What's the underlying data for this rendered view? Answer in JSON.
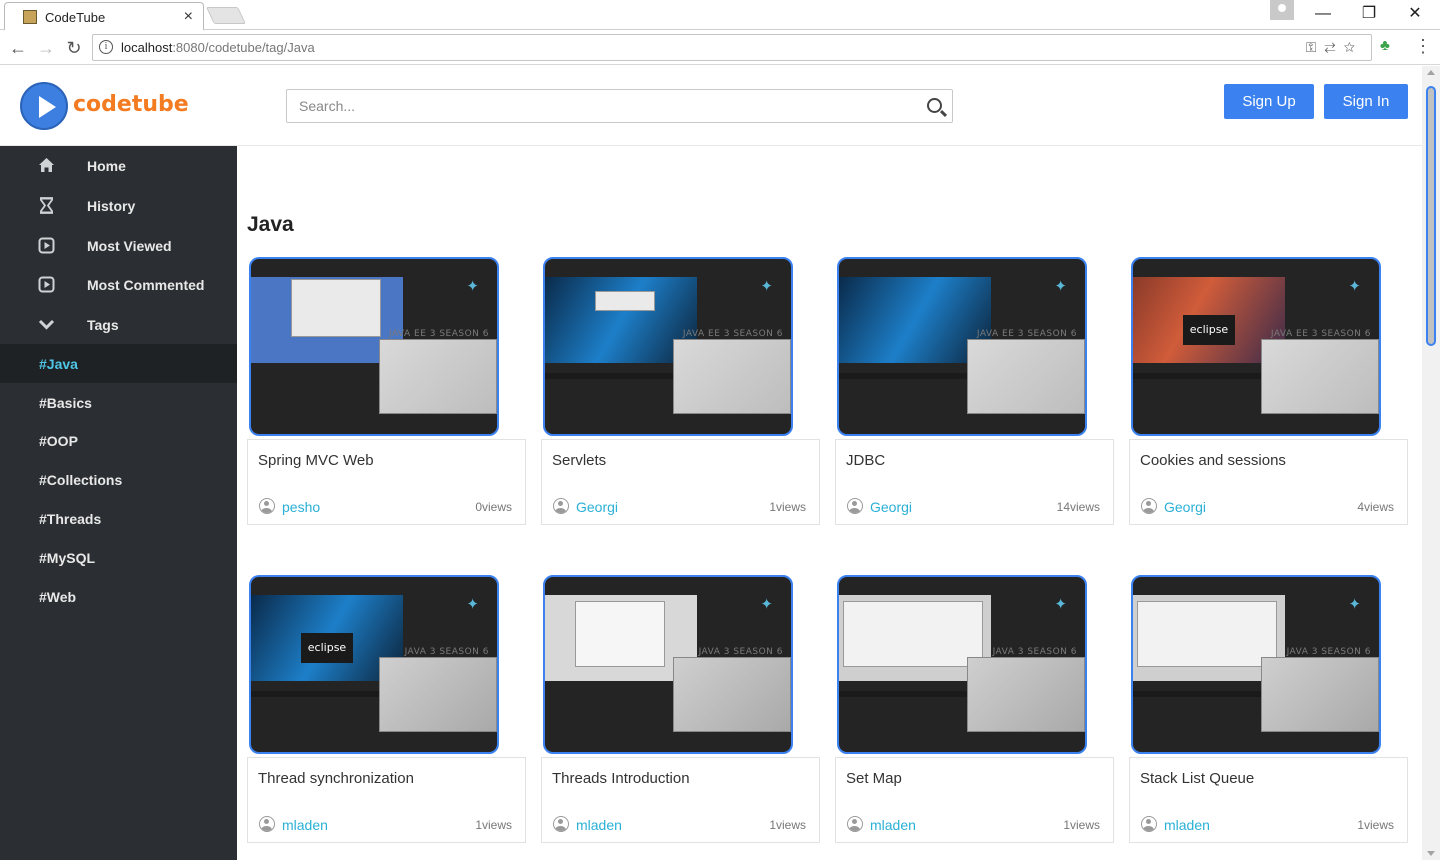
{
  "browser": {
    "tab_title": "CodeTube",
    "tab_close": "×",
    "url_host": "localhost",
    "url_rest": ":8080/codetube/tag/Java",
    "window_controls": [
      "—",
      "❐",
      "✕"
    ]
  },
  "header": {
    "logo_text": "codetube",
    "search_placeholder": "Search...",
    "sign_up_label": "Sign Up",
    "sign_in_label": "Sign In"
  },
  "sidebar": {
    "nav": [
      {
        "label": "Home",
        "icon": "home-icon"
      },
      {
        "label": "History",
        "icon": "hourglass-icon"
      },
      {
        "label": "Most Viewed",
        "icon": "play-square-icon"
      },
      {
        "label": "Most Commented",
        "icon": "play-square-icon"
      },
      {
        "label": "Tags",
        "icon": "chevron-down-icon"
      }
    ],
    "tags": [
      "#Java",
      "#Basics",
      "#OOP",
      "#Collections",
      "#Threads",
      "#MySQL",
      "#Web"
    ],
    "active_tag": "#Java"
  },
  "main": {
    "section_title": "Java",
    "videos": [
      {
        "title": "Spring MVC Web",
        "author": "pesho",
        "views": "0views",
        "season": "JAVA EE 3 SEASON 6"
      },
      {
        "title": "Servlets",
        "author": "Georgi",
        "views": "1views",
        "season": "JAVA EE 3 SEASON 6"
      },
      {
        "title": "JDBC",
        "author": "Georgi",
        "views": "14views",
        "season": "JAVA EE 3 SEASON 6"
      },
      {
        "title": "Cookies and sessions",
        "author": "Georgi",
        "views": "4views",
        "season": "JAVA EE 3 SEASON 6"
      },
      {
        "title": "Thread synchronization",
        "author": "mladen",
        "views": "1views",
        "season": "JAVA 3 SEASON 6"
      },
      {
        "title": "Threads Introduction",
        "author": "mladen",
        "views": "1views",
        "season": "JAVA 3 SEASON 6"
      },
      {
        "title": "Set Map",
        "author": "mladen",
        "views": "1views",
        "season": "JAVA 3 SEASON 6"
      },
      {
        "title": "Stack List Queue",
        "author": "mladen",
        "views": "1views",
        "season": "JAVA 3 SEASON 6"
      }
    ]
  },
  "colors": {
    "accent_blue": "#3b82f0",
    "logo_orange": "#f37b21",
    "sidebar_bg": "#2b2f33",
    "active_tag": "#4ec6e6",
    "author_link": "#2bb0d6"
  }
}
